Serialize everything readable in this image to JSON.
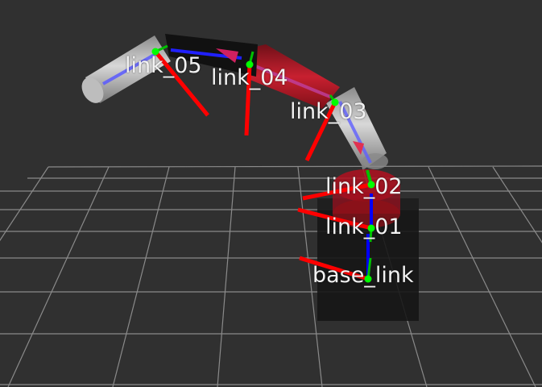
{
  "scene": {
    "background_color": "#303030",
    "grid_color": "#a0a0a0",
    "frames": [
      {
        "id": "link_05",
        "label": "link_05"
      },
      {
        "id": "link_04",
        "label": "link_04"
      },
      {
        "id": "link_03",
        "label": "link_03"
      },
      {
        "id": "link_02",
        "label": "link_02"
      },
      {
        "id": "link_01",
        "label": "link_01"
      },
      {
        "id": "base_link",
        "label": "base_link"
      }
    ],
    "colors": {
      "x_axis": "#ff0000",
      "y_axis": "#00c000",
      "z_axis": "#0000ff",
      "frame_point": "#00ff00",
      "link_grey": "#b8b8b8",
      "link_dark": "#111111",
      "link_red": "#c01020",
      "base_block": "#151515"
    }
  }
}
